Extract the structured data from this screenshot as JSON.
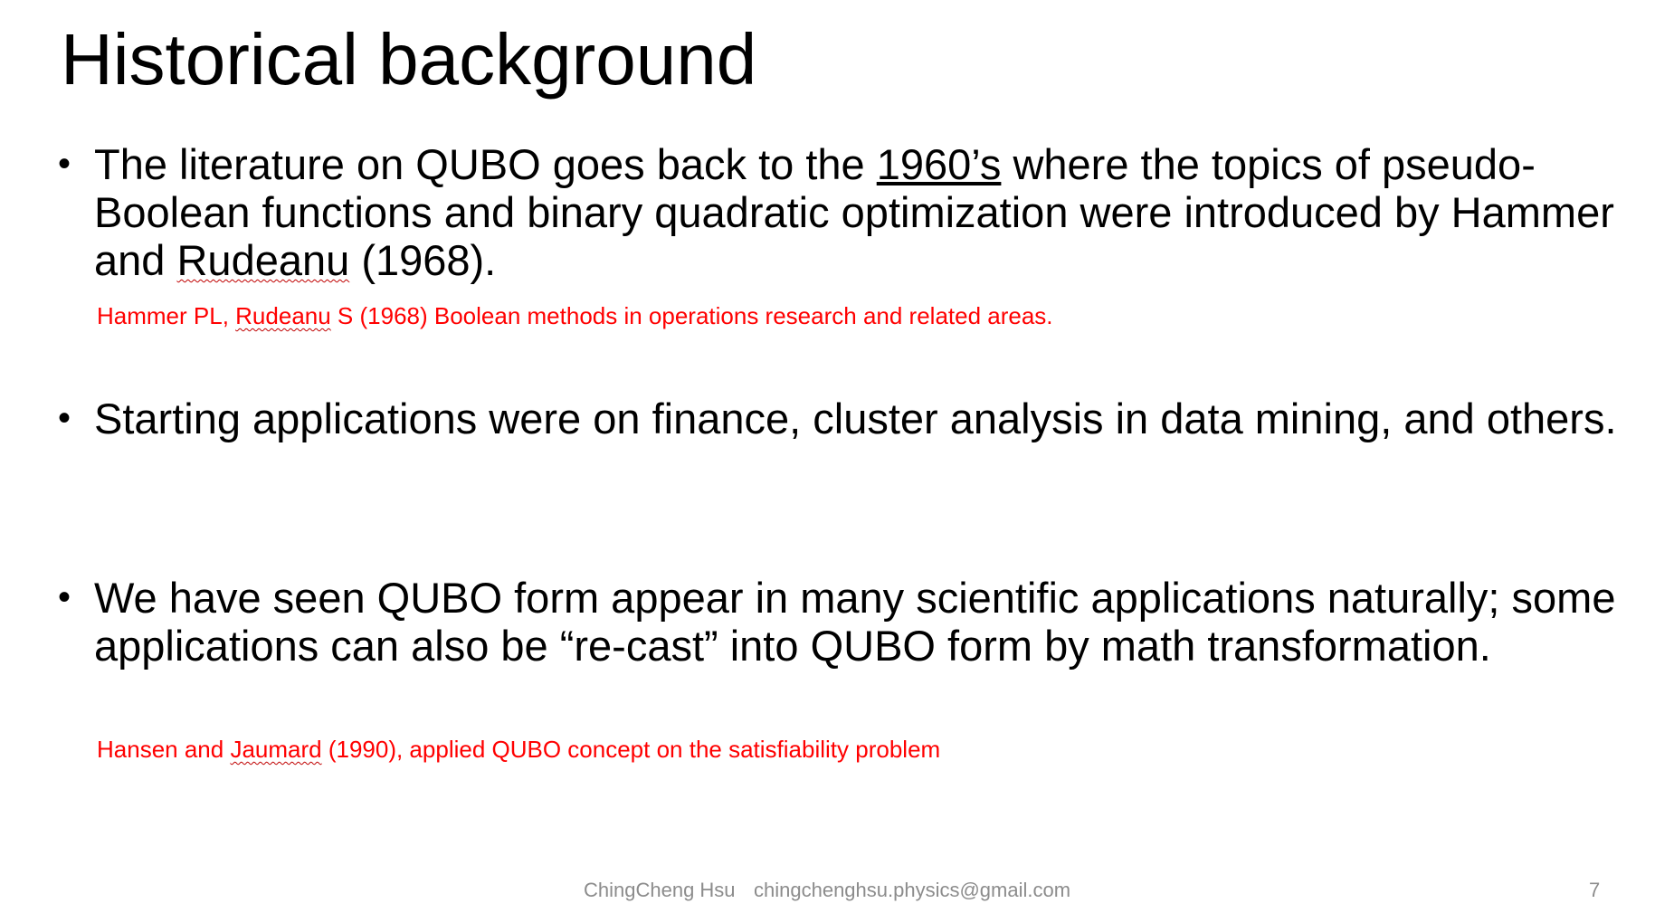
{
  "slide": {
    "title": "Historical background",
    "bullets": [
      {
        "marker": "•",
        "part1": "The literature on QUBO goes back to the ",
        "underlined": "1960’s",
        "part2": " where the topics of pseudo-Boolean functions and binary quadratic optimization were introduced by Hammer and ",
        "name": "Rudeanu",
        "part3": " (1968)."
      },
      {
        "marker": "•",
        "text": "Starting applications were on finance, cluster analysis in data mining, and others."
      },
      {
        "marker": "•",
        "text": "We have seen QUBO form appear in many scientific applications naturally; some applications can also be “re-cast” into QUBO form by math transformation."
      }
    ],
    "references": [
      {
        "part1": "Hammer PL, ",
        "name": "Rudeanu",
        "part2": " S (1968) Boolean methods in operations research and related areas."
      },
      {
        "part1": "Hansen and ",
        "name": "Jaumard",
        "part2": " (1990), applied QUBO concept  on the satisfiability problem"
      }
    ],
    "footer": {
      "author": "ChingCheng Hsu",
      "email": "chingchenghsu.physics@gmail.com",
      "page_number": "7"
    }
  }
}
